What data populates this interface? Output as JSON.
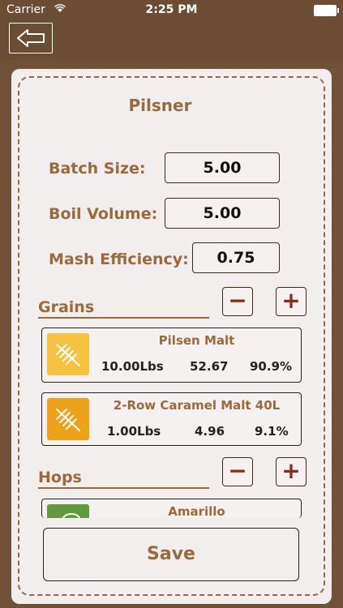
{
  "status_bar": {
    "carrier": "Carrier",
    "time": "2:25 PM"
  },
  "recipe": {
    "title": "Pilsner",
    "batch_size": {
      "label": "Batch Size:",
      "value": "5.00"
    },
    "boil_volume": {
      "label": "Boil Volume:",
      "value": "5.00"
    },
    "mash_efficiency": {
      "label": "Mash Efficiency:",
      "value": "0.75"
    }
  },
  "grains": {
    "label": "Grains",
    "minus": "−",
    "plus": "+",
    "items": [
      {
        "name": "Pilsen Malt",
        "weight": "10.00Lbs",
        "value": "52.67",
        "percent": "90.9%",
        "color": "#f7c23f"
      },
      {
        "name": "2-Row Caramel Malt 40L",
        "weight": "1.00Lbs",
        "value": "4.96",
        "percent": "9.1%",
        "color": "#eda21a"
      }
    ]
  },
  "hops": {
    "label": "Hops",
    "minus": "−",
    "plus": "+",
    "items": [
      {
        "name": "Amarillo",
        "color": "#5f9a3b"
      }
    ]
  },
  "save_label": "Save"
}
